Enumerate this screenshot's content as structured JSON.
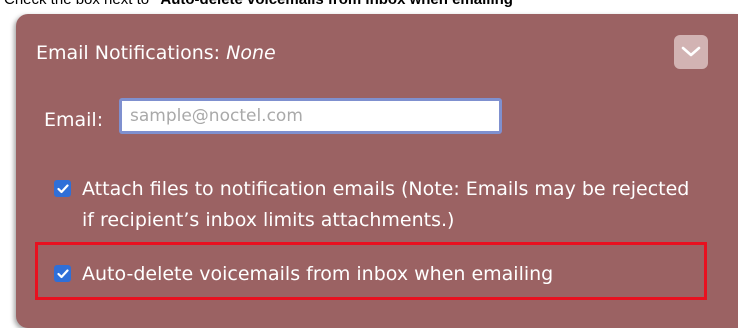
{
  "instruction": {
    "prefix": "Check the box next to ",
    "target": "\"Auto-delete voicemails from inbox when emailing\""
  },
  "notifications": {
    "title": "Email Notifications: ",
    "value": "None",
    "collapse_icon": "chevron-down-icon"
  },
  "email": {
    "label": "Email:",
    "value": "",
    "placeholder": "sample@noctel.com"
  },
  "options": {
    "attach_files": {
      "label": "Attach files to notification emails (Note: Emails may be rejected if recipient’s inbox limits attachments.)",
      "checked": true
    },
    "auto_delete": {
      "label": "Auto-delete voicemails from inbox when emailing",
      "checked": true
    }
  },
  "colors": {
    "panel_bg": "#9b6263",
    "checkbox": "#2f6fd8",
    "highlight": "#e8101f"
  }
}
